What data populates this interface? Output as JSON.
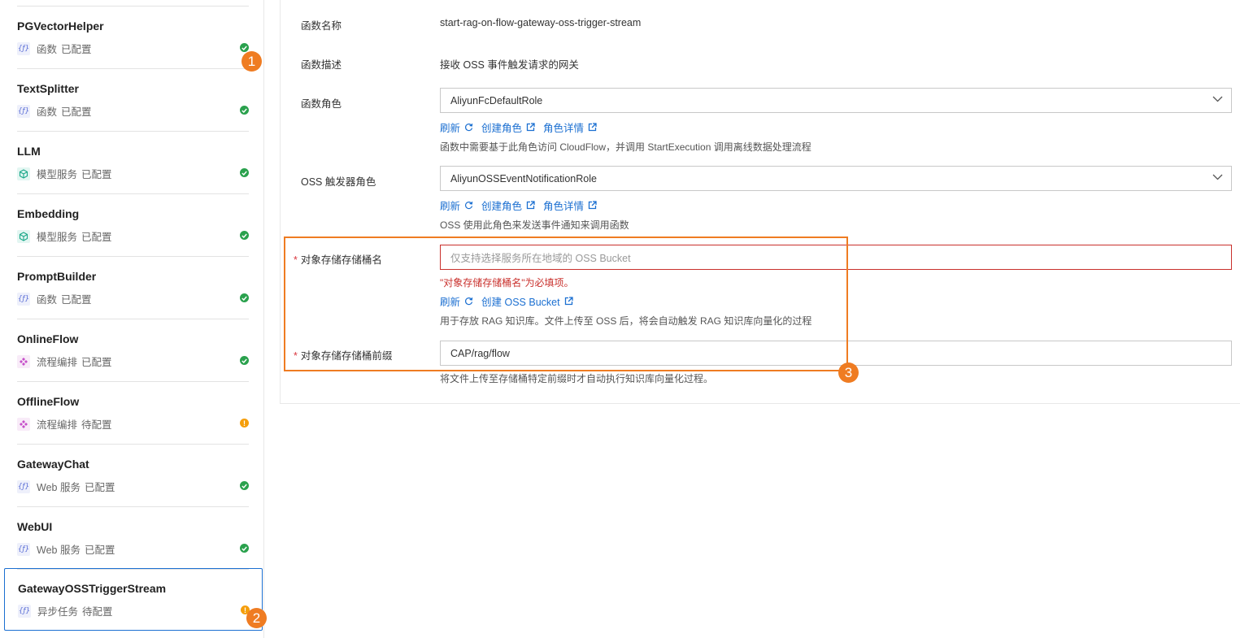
{
  "sidebar": {
    "items": [
      {
        "name": "PGVectorHelper",
        "type": "函数",
        "status": "已配置",
        "icon": "function-icon",
        "state": "ok"
      },
      {
        "name": "TextSplitter",
        "type": "函数",
        "status": "已配置",
        "icon": "function-icon",
        "state": "ok"
      },
      {
        "name": "LLM",
        "type": "模型服务",
        "status": "已配置",
        "icon": "cube-icon",
        "state": "ok"
      },
      {
        "name": "Embedding",
        "type": "模型服务",
        "status": "已配置",
        "icon": "cube-icon",
        "state": "ok"
      },
      {
        "name": "PromptBuilder",
        "type": "函数",
        "status": "已配置",
        "icon": "function-icon",
        "state": "ok"
      },
      {
        "name": "OnlineFlow",
        "type": "流程编排",
        "status": "已配置",
        "icon": "flow-icon",
        "state": "ok"
      },
      {
        "name": "OfflineFlow",
        "type": "流程编排",
        "status": "待配置",
        "icon": "flow-icon",
        "state": "warn"
      },
      {
        "name": "GatewayChat",
        "type": "Web 服务",
        "status": "已配置",
        "icon": "function-icon",
        "state": "ok"
      },
      {
        "name": "WebUI",
        "type": "Web 服务",
        "status": "已配置",
        "icon": "function-icon",
        "state": "ok"
      },
      {
        "name": "GatewayOSSTriggerStream",
        "type": "异步任务",
        "status": "待配置",
        "icon": "function-icon",
        "state": "warn",
        "selected": true
      }
    ]
  },
  "annotations": [
    "1",
    "2",
    "3"
  ],
  "form": {
    "fn_name": {
      "label": "函数名称",
      "value": "start-rag-on-flow-gateway-oss-trigger-stream"
    },
    "fn_desc": {
      "label": "函数描述",
      "value": "接收 OSS 事件触发请求的网关"
    },
    "fn_role": {
      "label": "函数角色",
      "value": "AliyunFcDefaultRole",
      "refresh": "刷新",
      "create": "创建角色",
      "details": "角色详情",
      "hint": "函数中需要基于此角色访问 CloudFlow，并调用 StartExecution 调用离线数据处理流程"
    },
    "oss_role": {
      "label": "OSS 触发器角色",
      "value": "AliyunOSSEventNotificationRole",
      "refresh": "刷新",
      "create": "创建角色",
      "details": "角色详情",
      "hint": "OSS 使用此角色来发送事件通知来调用函数"
    },
    "bucket": {
      "required": "*",
      "label": "对象存储存储桶名",
      "placeholder": "仅支持选择服务所在地域的 OSS Bucket",
      "error": "\"对象存储存储桶名\"为必填项。",
      "refresh": "刷新",
      "create": "创建 OSS Bucket",
      "hint": "用于存放 RAG 知识库。文件上传至 OSS 后，将会自动触发 RAG 知识库向量化的过程"
    },
    "prefix": {
      "required": "*",
      "label": "对象存储存储桶前缀",
      "value": "CAP/rag/flow",
      "hint": "将文件上传至存储桶特定前缀时才自动执行知识库向量化过程。"
    }
  },
  "colors": {
    "accent": "#1b6fd1",
    "ok": "#2aa14d",
    "warn": "#f59e0b",
    "annotation": "#ef7c22",
    "error": "#c9302c"
  }
}
